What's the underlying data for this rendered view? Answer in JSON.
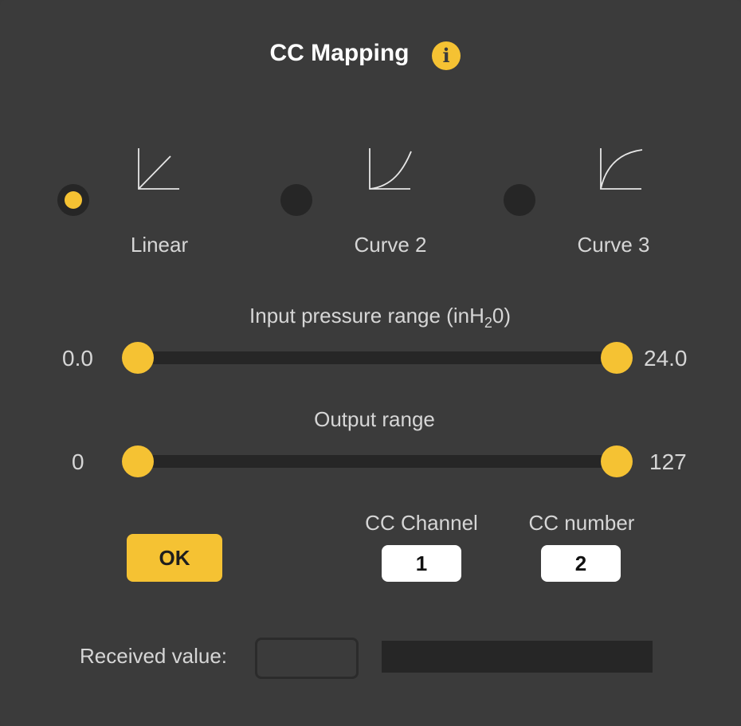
{
  "dialog": {
    "title": "CC Mapping",
    "info_icon": "info-icon"
  },
  "curves": {
    "selected": "Linear",
    "options": [
      {
        "label": "Linear",
        "icon": "linear-curve-icon",
        "selected": true
      },
      {
        "label": "Curve 2",
        "icon": "exponential-curve-icon",
        "selected": false
      },
      {
        "label": "Curve 3",
        "icon": "logarithmic-curve-icon",
        "selected": false
      }
    ]
  },
  "input_range": {
    "label_prefix": "Input pressure range (inH",
    "label_sub": "2",
    "label_suffix": "0)",
    "min_label": "0.0",
    "max_label": "24.0",
    "min_value": 0.0,
    "max_value": 24.0,
    "low_fraction": 0,
    "high_fraction": 1
  },
  "output_range": {
    "label": "Output range",
    "min_label": "0",
    "max_label": "127",
    "min_value": 0,
    "max_value": 127,
    "low_fraction": 0,
    "high_fraction": 1
  },
  "buttons": {
    "ok": "OK"
  },
  "cc_channel": {
    "label": "CC Channel",
    "value": "1"
  },
  "cc_number": {
    "label": "CC number",
    "value": "2"
  },
  "received": {
    "label": "Received value:",
    "value": ""
  },
  "colors": {
    "accent": "#f5c233",
    "background": "#3b3b3b",
    "track": "#262626"
  }
}
